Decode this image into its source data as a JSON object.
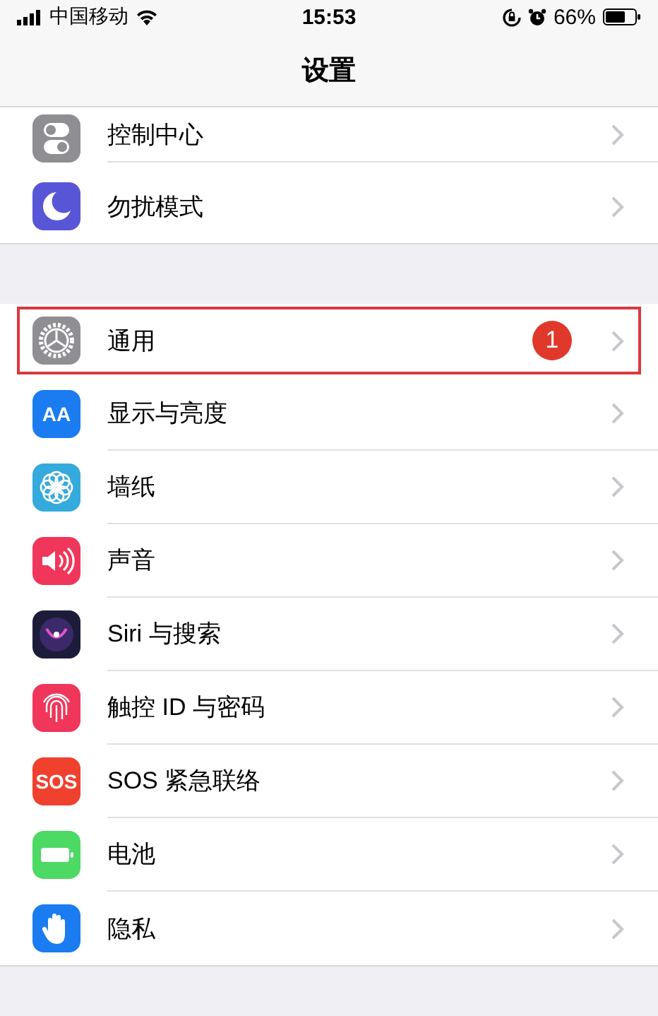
{
  "status_bar": {
    "carrier": "中国移动",
    "time": "15:53",
    "battery": "66%"
  },
  "nav": {
    "title": "设置"
  },
  "groups": [
    {
      "items": [
        {
          "label": "控制中心",
          "kind": "toggles",
          "color": "#8e8e93",
          "highlighted": false
        },
        {
          "label": "勿扰模式",
          "kind": "moon",
          "color": "#5856d6",
          "highlighted": false
        }
      ]
    },
    {
      "items": [
        {
          "label": "通用",
          "kind": "gear",
          "color": "#8e8e93",
          "badge": "1",
          "highlighted": true
        },
        {
          "label": "显示与亮度",
          "kind": "text",
          "icon_text": "AA",
          "color": "#1a7cf0",
          "highlighted": false
        },
        {
          "label": "墙纸",
          "kind": "flower",
          "color": "#35aadc",
          "highlighted": false
        },
        {
          "label": "声音",
          "kind": "speaker",
          "color": "#f0365a",
          "highlighted": false
        },
        {
          "label": "Siri 与搜索",
          "kind": "siri",
          "color": "#1c1c3a",
          "highlighted": false
        },
        {
          "label": "触控 ID 与密码",
          "kind": "fingerprint",
          "color": "#f0365a",
          "highlighted": false
        },
        {
          "label": "SOS 紧急联络",
          "kind": "text",
          "icon_text": "SOS",
          "color": "#f0402e",
          "highlighted": false
        },
        {
          "label": "电池",
          "kind": "battery",
          "color": "#4cd964",
          "highlighted": false
        },
        {
          "label": "隐私",
          "kind": "hand",
          "color": "#1a7cf0",
          "highlighted": false
        }
      ]
    }
  ]
}
